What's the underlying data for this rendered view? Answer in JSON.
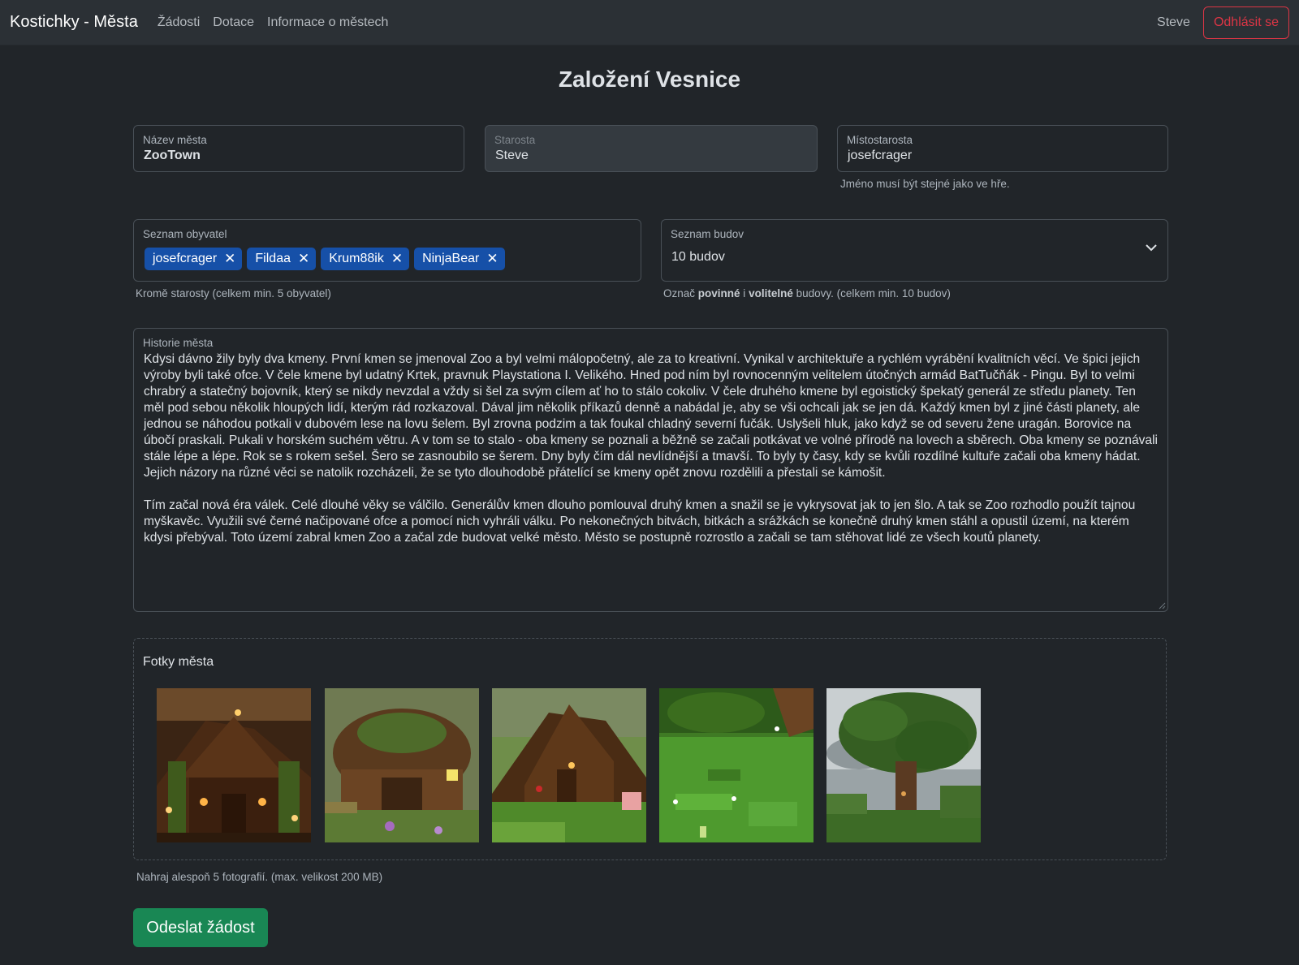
{
  "navbar": {
    "brand": "Kostichky - Města",
    "links": [
      "Žádosti",
      "Dotace",
      "Informace o městech"
    ],
    "user": "Steve",
    "logout_label": "Odhlásit se",
    "colors": {
      "background": "#2b3035",
      "logout": "#dc3545"
    }
  },
  "page": {
    "title": "Založení Vesnice"
  },
  "fields": {
    "city_name": {
      "label": "Název města",
      "value": "ZooTown"
    },
    "mayor": {
      "label": "Starosta",
      "value": "Steve"
    },
    "deputy": {
      "label": "Místostarosta",
      "value": "josefcrager",
      "help": "Jméno musí být stejné jako ve hře."
    },
    "residents": {
      "label": "Seznam obyvatel",
      "tags": [
        "josefcrager",
        "Fildaa",
        "Krum88ik",
        "NinjaBear"
      ],
      "help": "Kromě starosty (celkem min. 5 obyvatel)"
    },
    "buildings": {
      "label": "Seznam budov",
      "value": "10 budov",
      "help_prefix": "Označ ",
      "help_bold1": "povinné",
      "help_mid": " i ",
      "help_bold2": "volitelné",
      "help_suffix": " budovy. (celkem min. 10 budov)"
    },
    "history": {
      "label": "Historie města",
      "text": "Kdysi dávno žily byly dva kmeny. První kmen se jmenoval Zoo a byl velmi málopočetný, ale za to kreativní. Vynikal v architektuře a rychlém vyrábění kvalitních věcí. Ve špici jejich výroby byli také ofce. V čele kmene byl udatný Krtek, pravnuk Playstationa I. Velikého. Hned pod ním byl rovnocenným velitelem útočných armád BatTučňák - Pingu. Byl to velmi chrabrý a statečný bojovník, který se nikdy nevzdal a vždy si šel za svým cílem ať ho to stálo cokoliv. V čele druhého kmene byl egoistický špekatý generál ze středu planety. Ten měl pod sebou několik hloupých lidí, kterým rád rozkazoval. Dával jim několik příkazů denně a nabádal je, aby se vši ochcali jak se jen dá. Každý kmen byl z jiné části planety, ale jednou se náhodou potkali v dubovém lese na lovu šelem. Byl zrovna podzim a tak foukal chladný severní fučák. Uslyšeli hluk, jako když se od severu žene uragán. Borovice na úbočí praskali. Pukali v horském suchém větru. A v tom se to stalo - oba kmeny se poznali a běžně se začali potkávat ve volné přírodě na lovech a sběrech. Oba kmeny se poznávali stále lépe a lépe. Rok se s rokem sešel. Šero se zasnoubilo se šerem. Dny byly čím dál nevlídnější a tmavší. To byly ty časy, kdy se kvůli rozdílné kultuře začali oba kmeny hádat. Jejich názory na různé věci se natolik rozcházeli, že se tyto dlouhodobě přátelící se kmeny opět znovu rozdělili a přestali se kámošit.\n\nTím začal nová éra válek. Celé dlouhé věky se válčilo. Generálův kmen dlouho pomlouval druhý kmen a snažil se je vykrysovat jak to jen šlo. A tak se Zoo rozhodlo použít tajnou myškavěc. Využili své černé načipované ofce a pomocí nich vyhráli válku. Po nekonečných bitvách, bitkách a srážkách se konečně druhý kmen stáhl a opustil území, na kterém kdysi přebýval. Toto území zabral kmen Zoo a začal zde budovat velké město. Město se postupně rozrostlo a začali se tam stěhovat lidé ze všech koutů planety."
    }
  },
  "photos": {
    "title": "Fotky města",
    "help": "Nahraj alespoň 5 fotografií. (max. velikost 200 MB)"
  },
  "submit_label": "Odeslat žádost",
  "accent_colors": {
    "tag": "#1650a8",
    "submit": "#198754"
  }
}
